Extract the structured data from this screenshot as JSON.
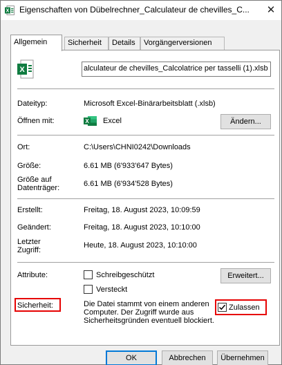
{
  "title": "Eigenschaften von Dübelrechner_Calculateur de chevilles_C...",
  "close_glyph": "✕",
  "tabs": [
    "Allgemein",
    "Sicherheit",
    "Details",
    "Vorgängerversionen"
  ],
  "filename": "alculateur de chevilles_Calcolatrice per tasselli (1).xlsb",
  "rows": {
    "type_label": "Dateityp:",
    "type_value": "Microsoft Excel-Binärarbeitsblatt (.xlsb)",
    "open_label": "Öffnen mit:",
    "open_value": "Excel",
    "change_button": "Ändern...",
    "location_label": "Ort:",
    "location_value": "C:\\Users\\CHNI0242\\Downloads",
    "size_label": "Größe:",
    "size_value": "6.61 MB (6'933'647 Bytes)",
    "disk_label_1": "Größe auf",
    "disk_label_2": "Datenträger:",
    "disk_value": "6.61 MB (6'934'528 Bytes)",
    "created_label": "Erstellt:",
    "created_value": "Freitag, 18. August 2023, 10:09:59",
    "modified_label": "Geändert:",
    "modified_value": "Freitag, 18. August 2023, 10:10:00",
    "accessed_label_1": "Letzter",
    "accessed_label_2": "Zugriff:",
    "accessed_value": "Heute, 18. August 2023, 10:10:00",
    "attributes_label": "Attribute:",
    "readonly_label": "Schreibgeschützt",
    "hidden_label": "Versteckt",
    "advanced_button": "Erweitert...",
    "security_label": "Sicherheit:",
    "security_text": "Die Datei stammt von einem anderen Computer. Der Zugriff wurde aus Sicherheitsgründen eventuell blockiert.",
    "unblock_label": "Zulassen"
  },
  "buttons": {
    "ok": "OK",
    "cancel": "Abbrechen",
    "apply": "Übernehmen"
  },
  "colors": {
    "highlight": "#e60000",
    "excel_green": "#107c41",
    "accent": "#0078d7"
  },
  "icons": {
    "title": "excel-file-icon",
    "file": "excel-file-icon",
    "open_with": "excel-app-icon"
  }
}
